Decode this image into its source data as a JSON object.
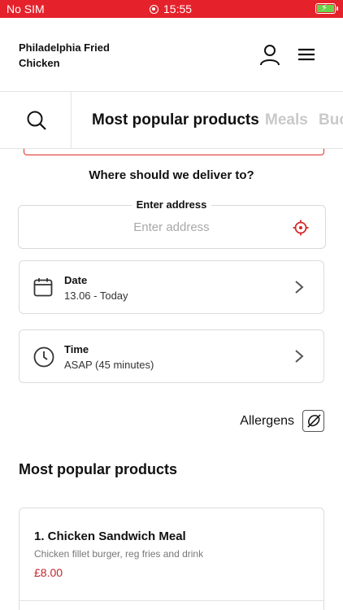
{
  "status_bar": {
    "carrier": "No SIM",
    "time": "15:55",
    "battery_color": "#6ad34a"
  },
  "header": {
    "brand": "Philadelphia Fried Chicken",
    "icons": [
      "user-icon",
      "menu-icon"
    ]
  },
  "tabs": {
    "items": [
      {
        "label": "Most popular products",
        "active": true
      },
      {
        "label": "Meals",
        "active": false
      },
      {
        "label": "Buc",
        "active": false
      }
    ]
  },
  "delivery": {
    "question": "Where should we deliver to?",
    "address_label": "Enter address",
    "address_placeholder": "Enter address",
    "address_value": ""
  },
  "date": {
    "title": "Date",
    "value": "13.06 - Today"
  },
  "time": {
    "title": "Time",
    "value": "ASAP (45 minutes)"
  },
  "allergens": {
    "label": "Allergens"
  },
  "popular": {
    "title": "Most popular products",
    "products": [
      {
        "name": "1. Chicken Sandwich Meal",
        "description": "Chicken fillet burger, reg fries and drink",
        "price": "£8.00"
      }
    ]
  },
  "colors": {
    "brand_red": "#e5222b",
    "price_red": "#c0262b",
    "inactive_tab": "#c9c9c9"
  }
}
